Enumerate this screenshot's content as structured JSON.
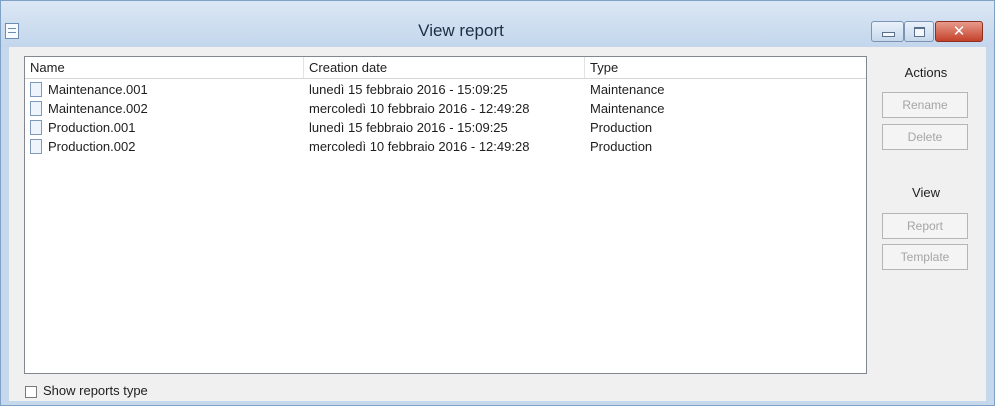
{
  "window": {
    "title": "View report",
    "controls": {
      "minimize_icon": "minimize-icon",
      "maximize_icon": "maximize-icon",
      "close_icon": "close-icon",
      "close_glyph": "✕"
    }
  },
  "list": {
    "columns": [
      "Name",
      "Creation date",
      "Type"
    ],
    "rows": [
      {
        "name": "Maintenance.001",
        "date": "lunedì 15 febbraio 2016 - 15:09:25",
        "type": "Maintenance"
      },
      {
        "name": "Maintenance.002",
        "date": "mercoledì 10 febbraio 2016 - 12:49:28",
        "type": "Maintenance"
      },
      {
        "name": "Production.001",
        "date": "lunedì 15 febbraio 2016 - 15:09:25",
        "type": "Production"
      },
      {
        "name": "Production.002",
        "date": "mercoledì 10 febbraio 2016 - 12:49:28",
        "type": "Production"
      }
    ]
  },
  "actions": {
    "title": "Actions",
    "rename": "Rename",
    "delete": "Delete"
  },
  "view": {
    "title": "View",
    "report": "Report",
    "template": "Template"
  },
  "footer": {
    "show_reports_type": "Show reports type",
    "show_reports_type_checked": false
  }
}
